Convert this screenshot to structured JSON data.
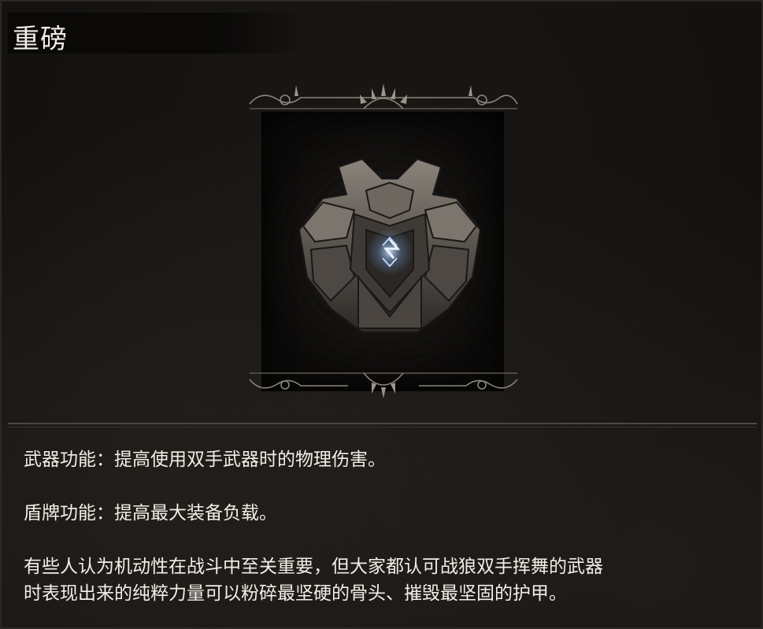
{
  "item": {
    "name": "重磅",
    "icon": "rune-stone-shield-icon",
    "accent_color": "#a8c8f0"
  },
  "description": {
    "weapon_effect": "武器功能：提高使用双手武器时的物理伤害。",
    "shield_effect": "盾牌功能：提高最大装备负载。",
    "lore_line1": "有些人认为机动性在战斗中至关重要，但大家都认可战狼双手挥舞的武器",
    "lore_line2": "时表现出来的纯粹力量可以粉碎最坚硬的骨头、摧毁最坚固的护甲。"
  }
}
